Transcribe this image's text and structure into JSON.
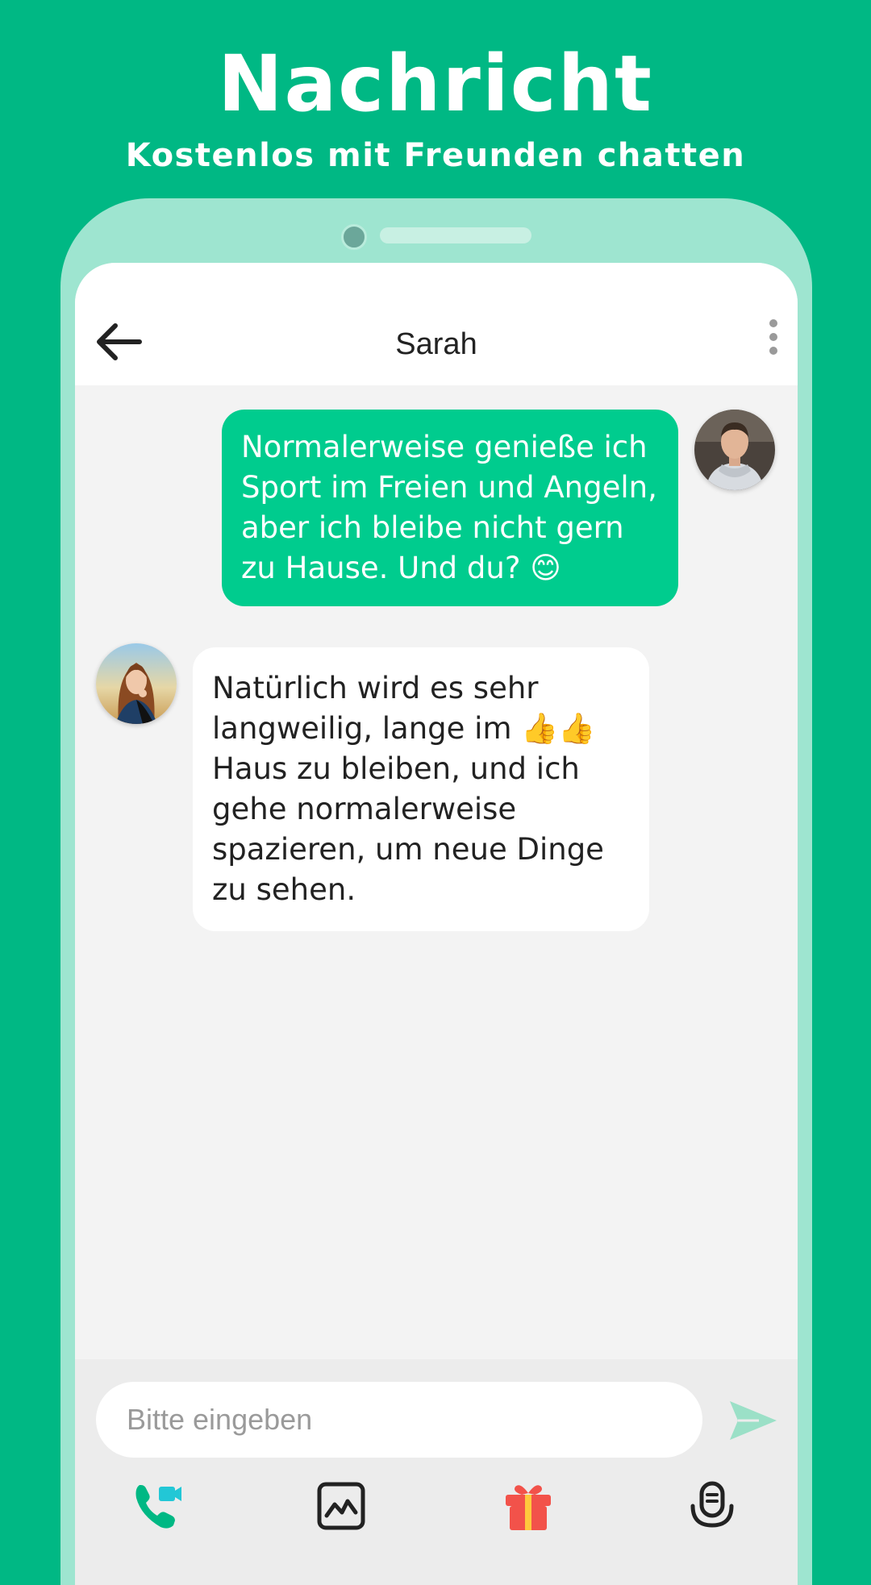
{
  "promo": {
    "title": "Nachricht",
    "subtitle": "Kostenlos mit Freunden chatten"
  },
  "header": {
    "title": "Sarah",
    "back_icon": "arrow-left-icon",
    "menu_icon": "more-vertical-icon"
  },
  "messages": [
    {
      "from": "me",
      "text": "Normalerweise genieße ich Sport im Freien und Angeln, aber ich bleibe nicht gern zu Hause. Und du? 😊"
    },
    {
      "from": "Sarah",
      "text": "Natürlich wird es sehr langweilig, lange im 👍👍 Haus zu bleiben, und ich gehe normalerweise spazieren, um neue Dinge zu sehen."
    }
  ],
  "composer": {
    "placeholder": "Bitte eingeben",
    "send_icon": "send-icon"
  },
  "toolbar": {
    "icons": [
      "video-call-icon",
      "image-icon",
      "gift-icon",
      "microphone-icon"
    ]
  },
  "colors": {
    "brand": "#00B884",
    "bubble_out": "#00CC8E",
    "gift": "#F2524A",
    "call": "#00B884",
    "video": "#22C7D6"
  }
}
